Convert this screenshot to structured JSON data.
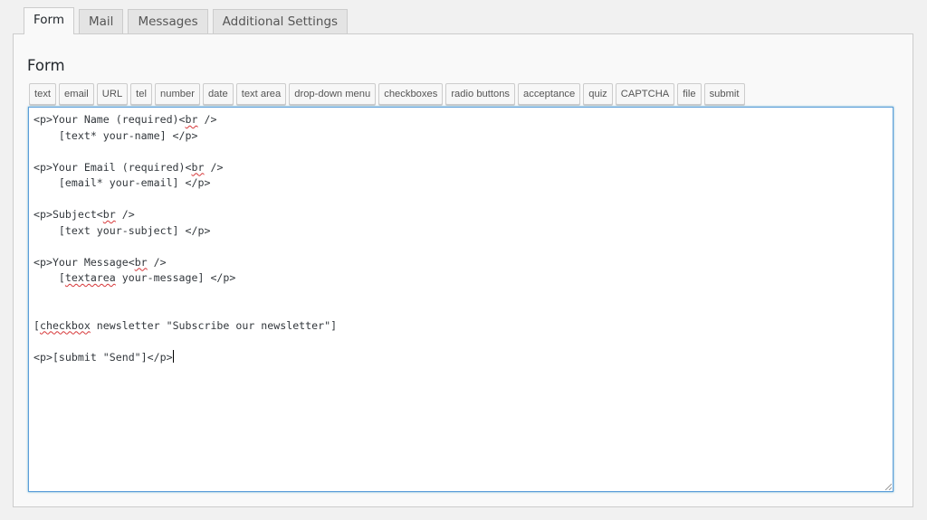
{
  "tabs": [
    {
      "label": "Form",
      "active": true
    },
    {
      "label": "Mail",
      "active": false
    },
    {
      "label": "Messages",
      "active": false
    },
    {
      "label": "Additional Settings",
      "active": false
    }
  ],
  "panel": {
    "title": "Form",
    "tag_buttons": [
      "text",
      "email",
      "URL",
      "tel",
      "number",
      "date",
      "text area",
      "drop-down menu",
      "checkboxes",
      "radio buttons",
      "acceptance",
      "quiz",
      "CAPTCHA",
      "file",
      "submit"
    ]
  },
  "editor": {
    "lines": [
      "<p>Your Name (required)<br />",
      "    [text* your-name] </p>",
      "",
      "<p>Your Email (required)<br />",
      "    [email* your-email] </p>",
      "",
      "<p>Subject<br />",
      "    [text your-subject] </p>",
      "",
      "<p>Your Message<br />",
      "    [textarea your-message] </p>",
      "",
      "",
      "[checkbox newsletter \"Subscribe our newsletter\"]",
      "",
      "<p>[submit \"Send\"]</p>"
    ],
    "spellcheck_words": [
      "br",
      "textarea",
      "checkbox"
    ]
  },
  "colors": {
    "accent_border": "#5b9dd9",
    "spellcheck": "#d63638"
  }
}
